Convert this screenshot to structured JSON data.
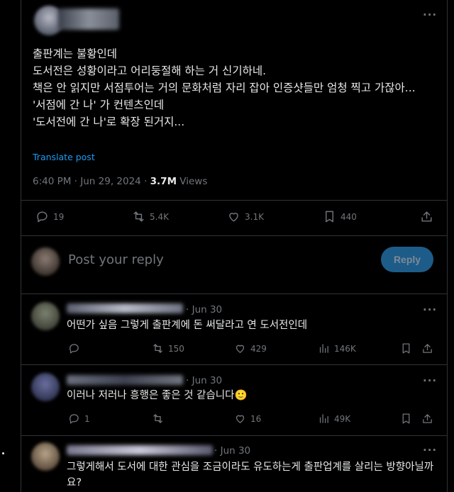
{
  "main_post": {
    "text": "출판계는 불황인데\n도서전은 성황이라고 어리둥절해 하는 거 신기하네.\n책은 안 읽지만 서점투어는 거의 문화처럼 자리 잡아 인증샷들만 엄청 찍고 가잖아...\n'서점에 간 나' 가 컨텐츠인데\n'도서전에 간 나'로 확장 된거지...",
    "translate_label": "Translate post",
    "timestamp": "6:40 PM · Jun 29, 2024 · ",
    "views_count": "3.7M",
    "views_label": " Views",
    "replies": "19",
    "reposts": "5.4K",
    "likes": "3.1K",
    "bookmarks": "440"
  },
  "reply_composer": {
    "placeholder": "Post your reply",
    "button_label": "Reply"
  },
  "replies": [
    {
      "date": "· Jun 30",
      "text": "어떤가 싶음 그렇게 출판계에 돈 써달라고 연 도서전인데",
      "replies": "",
      "reposts": "150",
      "likes": "429",
      "views": "146K"
    },
    {
      "date": "· Jun 30",
      "text": "이러나 저러나 흥행은 좋은 것 같습니다🙂",
      "replies": "1",
      "reposts": "",
      "likes": "16",
      "views": "49K"
    },
    {
      "date": "· Jun 30",
      "text": "그렇게해서 도서에 대한 관심을 조금이라도 유도하는게 출판업계를 살리는 방향아닐까요?"
    }
  ],
  "icons": {
    "more": "more-icon",
    "reply": "reply-icon",
    "repost": "repost-icon",
    "like": "heart-icon",
    "views": "views-icon",
    "bookmark": "bookmark-icon",
    "share": "share-icon"
  },
  "colors": {
    "background": "#000000",
    "text": "#e7e9ea",
    "muted": "#71767b",
    "accent": "#1d9bf0",
    "divider": "#2f3336"
  }
}
